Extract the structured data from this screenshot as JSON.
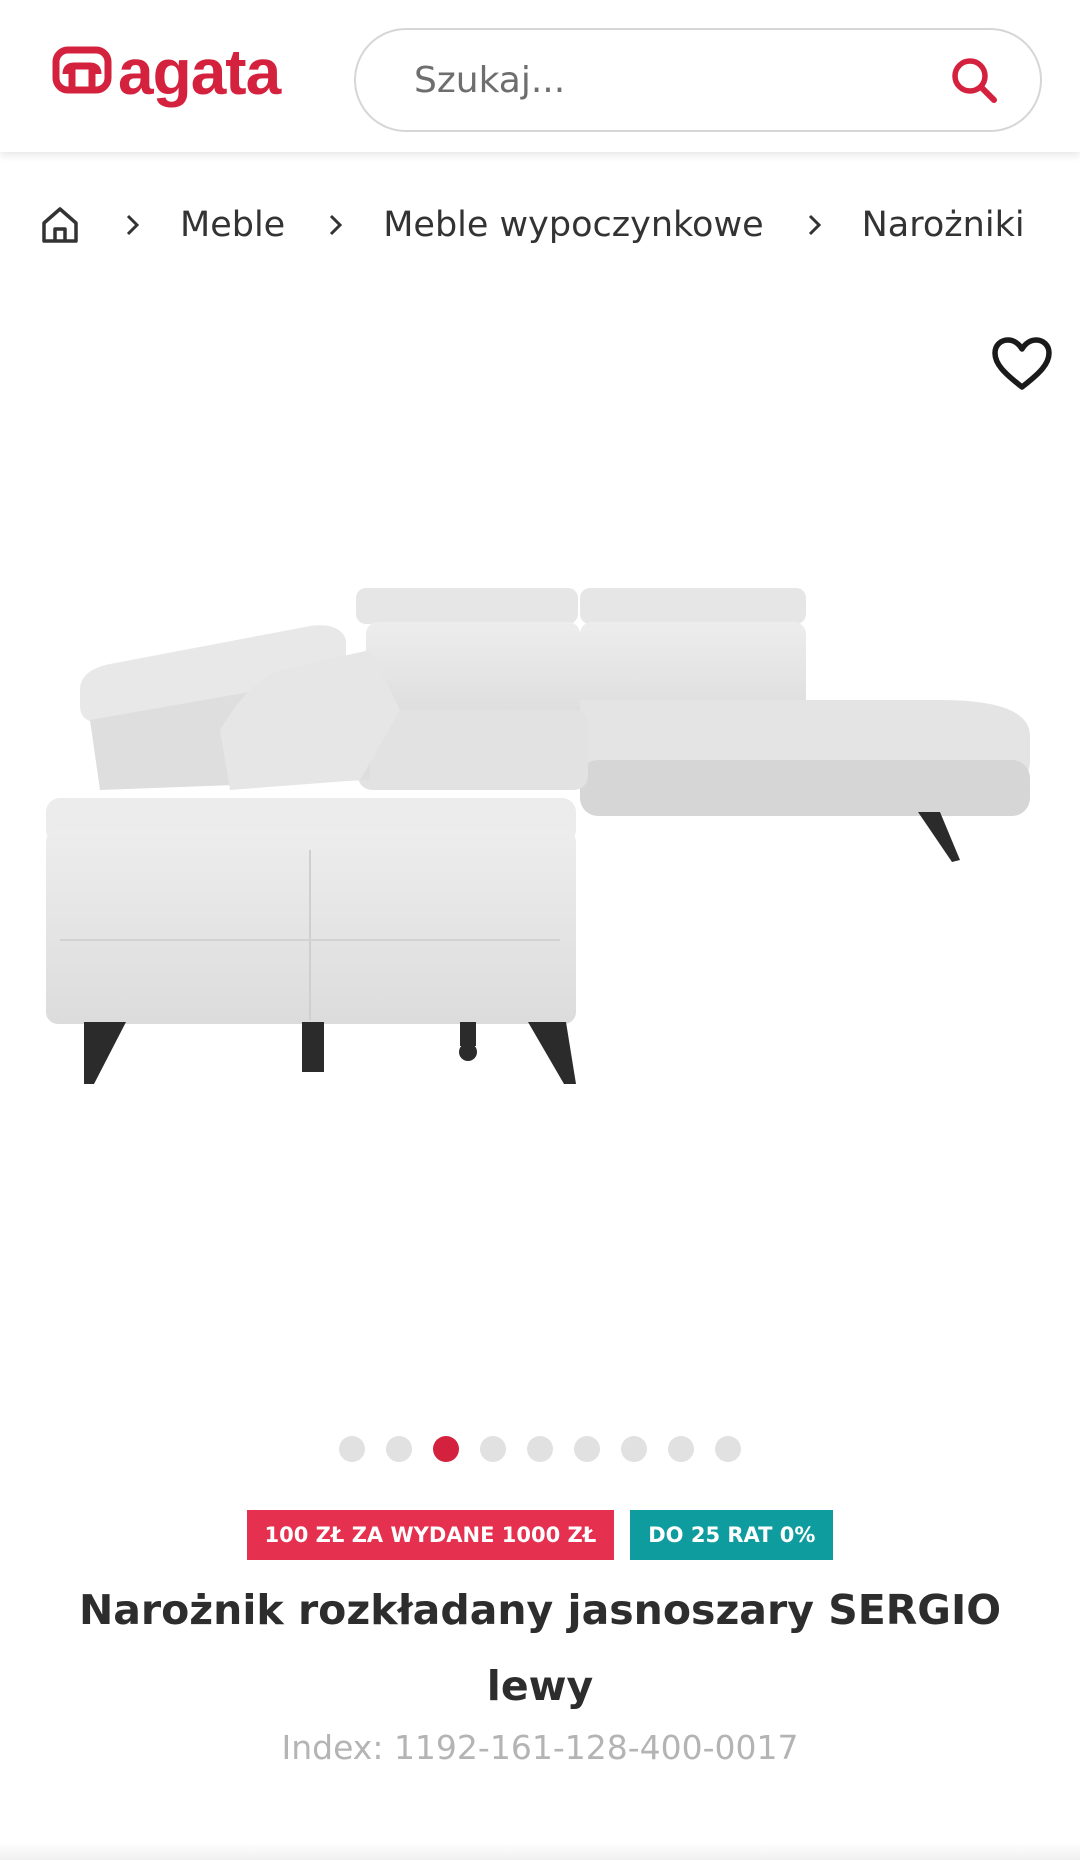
{
  "header": {
    "logo_text": "agata",
    "search_placeholder": "Szukaj..."
  },
  "breadcrumb": {
    "items": [
      "Meble",
      "Meble wypoczynkowe",
      "Narożniki"
    ]
  },
  "gallery": {
    "total_slides": 9,
    "active_slide": 3
  },
  "badges": {
    "promo": "100 ZŁ ZA WYDANE 1000 ZŁ",
    "installments": "DO 25 RAT 0%"
  },
  "product": {
    "title": "Narożnik rozkładany jasnoszary SERGIO lewy",
    "index": "Index: 1192-161-128-400-0017"
  },
  "colors": {
    "brand_red": "#d4213d",
    "badge_red": "#e5304f",
    "badge_teal": "#0f9c9e"
  },
  "icons": [
    "home-icon",
    "chevron-right-icon",
    "search-icon",
    "heart-icon"
  ]
}
